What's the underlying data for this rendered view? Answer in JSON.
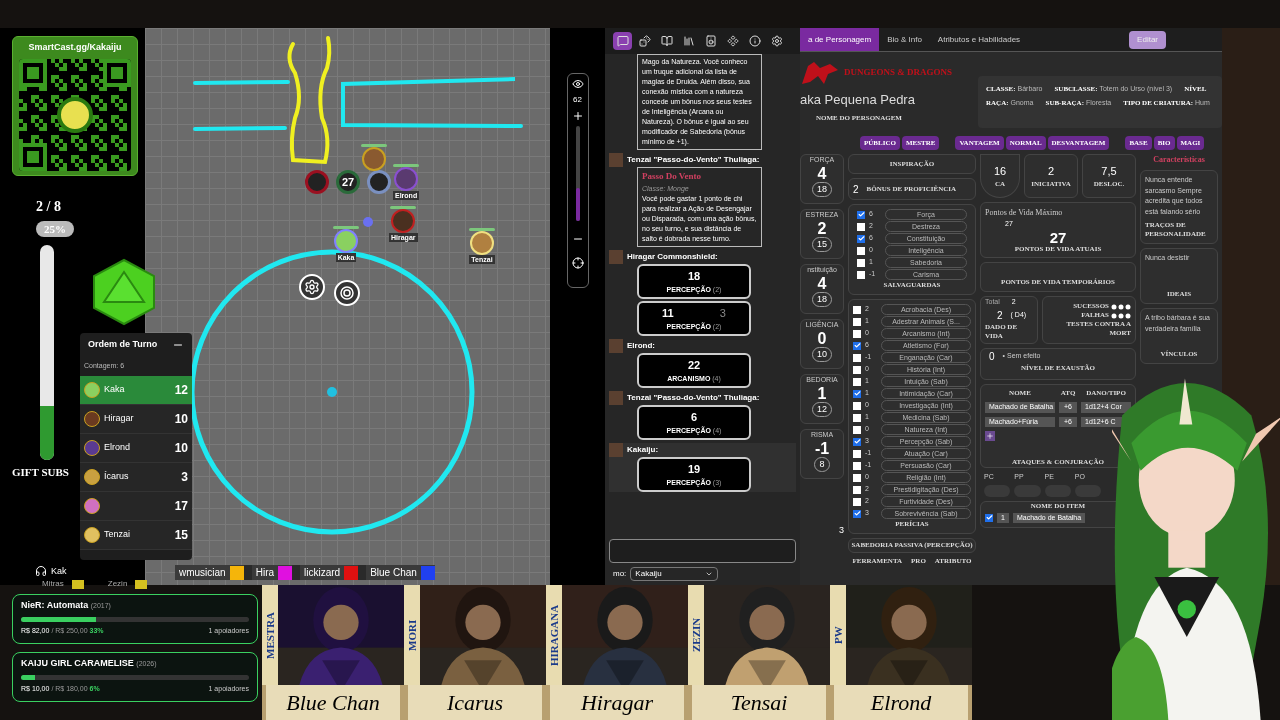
{
  "qr": {
    "url": "SmartCast.gg/Kakaiju"
  },
  "sub_goal": {
    "count": "2 / 8",
    "percent": "25%",
    "level": 0.25,
    "label": "GIFT SUBS"
  },
  "turn_order": {
    "title": "Ordem de Turno",
    "counter": "Contagem: 6",
    "entries": [
      {
        "name": "Kaka",
        "value": "12",
        "selected": true
      },
      {
        "name": "Hiragar",
        "value": "10",
        "selected": false
      },
      {
        "name": "Elrond",
        "value": "10",
        "selected": false
      },
      {
        "name": "Ícarus",
        "value": "3",
        "selected": false
      },
      {
        "value": "17",
        "selected": false
      },
      {
        "name": "Tenzai",
        "value": "15",
        "selected": false
      }
    ]
  },
  "voice": {
    "speaker": "Kak",
    "listeners": [
      {
        "name": "Mitras",
        "color": "#d4c020"
      },
      {
        "name": "Zezin",
        "color": "#d4c020"
      }
    ]
  },
  "players": [
    {
      "name": "wmusician",
      "color": "#f5b50a"
    },
    {
      "name": "Hira",
      "color": "#e010e0"
    },
    {
      "name": "lickizard",
      "color": "#e01010"
    },
    {
      "name": "Blue Chan",
      "color": "#2040f0"
    }
  ],
  "donation_goals": [
    {
      "title": "NieR: Automata",
      "year": "(2017)",
      "raised": "R$ 82,00",
      "target": "/ R$ 250,00",
      "percent": "33%",
      "level": 0.33,
      "supporters": "1 apoiadores"
    },
    {
      "title": "KAIJU GIRL CARAMELISE",
      "year": "(2026)",
      "raised": "R$ 10,00",
      "target": "/ R$ 180,00",
      "percent": "6%",
      "level": 0.06,
      "supporters": "1 apoiadores"
    }
  ],
  "map": {
    "zoom": {
      "value": "62",
      "level": 0.35
    },
    "hp_ring": "27",
    "tokens": [
      {
        "name": "Elrond"
      },
      {
        "name": "Hiragar"
      },
      {
        "name": "Kaka"
      },
      {
        "name": "Tenzai"
      }
    ]
  },
  "chat": {
    "tabs": [
      {
        "kind": "chat",
        "selected": true
      },
      {
        "kind": "dice",
        "selected": false
      },
      {
        "kind": "journal",
        "selected": false
      },
      {
        "kind": "library",
        "selected": false
      },
      {
        "kind": "jukebox",
        "selected": false
      },
      {
        "kind": "collections",
        "selected": false
      },
      {
        "kind": "info",
        "selected": false
      },
      {
        "kind": "settings",
        "selected": false
      }
    ],
    "messages": [
      {
        "kind": "card",
        "body": "Mago da Natureza. Você conheco um truque adicional da lista de magias de Druida. Além disso, sua conexão mística com a natureza concede um bônus nos seus testes de Inteligência (Arcana ou Natureza). O bônus é igual ao seu modificador de Sabedoria (bônus mínimo de +1)."
      },
      {
        "kind": "card",
        "author": "Tenzai \"Passo-do-Vento\" Thuliaga:",
        "title": "Passo Do Vento",
        "subtitle": "Classe: Monge",
        "body": "Você pode gastar 1 ponto de chi para realizar a Ação de Desengajar ou Disparada, com uma ação bônus, no seu turno, e sua distância de salto é dobrada nesse turno."
      },
      {
        "kind": "roll",
        "author": "Hiragar Commonshield:",
        "rolls": [
          {
            "values": [
              "18"
            ],
            "label": "PERCEPÇÃO",
            "mod": "(2)"
          },
          {
            "values": [
              "11",
              "3"
            ],
            "label": "PERCEPÇÃO",
            "mod": "(2)"
          }
        ]
      },
      {
        "kind": "roll",
        "author": "Elrond:",
        "rolls": [
          {
            "values": [
              "22"
            ],
            "label": "ARCANISMO",
            "mod": "(4)"
          }
        ]
      },
      {
        "kind": "roll",
        "author": "Tenzai \"Passo-do-Vento\" Thuliaga:",
        "rolls": [
          {
            "values": [
              "6"
            ],
            "label": "PERCEPÇÃO",
            "mod": "(4)"
          }
        ]
      },
      {
        "kind": "roll",
        "author": "Kakaiju:",
        "rolls": [
          {
            "values": [
              "19"
            ],
            "label": "PERCEPÇÃO",
            "mod": "(3)"
          }
        ]
      }
    ],
    "speaking_as_label": "mo:",
    "speaking_as": "Kakaiju"
  },
  "sheet": {
    "tabs": [
      {
        "label": "a de Personagem",
        "selected": true
      },
      {
        "label": "Bio & Info",
        "selected": false
      },
      {
        "label": "Atributos e Habilidades",
        "selected": false
      }
    ],
    "edit_button": "Editar",
    "logo": "DUNGEONS & DRAGONS",
    "name": "aka Pequena Pedra",
    "name_label": "NOME DO PERSONAGEM",
    "info": [
      {
        "label": "CLASSE:",
        "value": "Bárbaro"
      },
      {
        "label": "SUBCLASSE:",
        "value": "Totem do Urso (nível 3)"
      },
      {
        "label": "NÍVEL"
      },
      {
        "label": "RAÇA:",
        "value": "Gnoma"
      },
      {
        "label": "SUB-RAÇA:",
        "value": "Floresta"
      },
      {
        "label": "TIPO DE CRIATURA:",
        "value": "Hum"
      }
    ],
    "toggles": [
      [
        "PÚBLICO",
        "MESTRE"
      ],
      [
        "VANTAGEM",
        "NORMAL",
        "DESVANTAGEM"
      ],
      [
        "BASE",
        "BIO",
        "MAGI"
      ]
    ],
    "attributes": [
      {
        "label": "FORÇA",
        "mod": "4",
        "score": "18"
      },
      {
        "label": "ESTREZA",
        "mod": "2",
        "score": "15"
      },
      {
        "label": "nstituição",
        "mod": "4",
        "score": "18"
      },
      {
        "label": "LIGÊNCIA",
        "mod": "0",
        "score": "10"
      },
      {
        "label": "BEDORIA",
        "mod": "1",
        "score": "12"
      },
      {
        "label": "RISMA",
        "mod": "-1",
        "score": "8"
      }
    ],
    "inspiration": "INSPIRAÇÃO",
    "proficiency": "2",
    "proficiency_label": "BÔNUS DE PROFICIÊNCIA",
    "saves_title": "SALVAGUARDAS",
    "saves": [
      {
        "checked": true,
        "mod": "6",
        "name": "Força"
      },
      {
        "checked": false,
        "mod": "2",
        "name": "Destreza"
      },
      {
        "checked": true,
        "mod": "6",
        "name": "Constituição"
      },
      {
        "checked": false,
        "mod": "0",
        "name": "Inteligência"
      },
      {
        "checked": false,
        "mod": "1",
        "name": "Sabedoria"
      },
      {
        "checked": false,
        "mod": "-1",
        "name": "Carisma"
      }
    ],
    "skills_title": "PERÍCIAS",
    "skills": [
      {
        "checked": false,
        "mod": "2",
        "name": "Acrobacia (Des)"
      },
      {
        "checked": false,
        "mod": "1",
        "name": "Adestrar Animais (S..."
      },
      {
        "checked": false,
        "mod": "0",
        "name": "Arcanismo (Int)"
      },
      {
        "checked": true,
        "mod": "6",
        "name": "Atletismo (For)"
      },
      {
        "checked": false,
        "mod": "-1",
        "name": "Enganação (Car)"
      },
      {
        "checked": false,
        "mod": "0",
        "name": "História (Int)"
      },
      {
        "checked": false,
        "mod": "1",
        "name": "Intuição (Sab)"
      },
      {
        "checked": true,
        "mod": "1",
        "name": "Intimidação (Car)"
      },
      {
        "checked": false,
        "mod": "0",
        "name": "Investigação (Int)"
      },
      {
        "checked": false,
        "mod": "1",
        "name": "Medicina (Sab)"
      },
      {
        "checked": false,
        "mod": "0",
        "name": "Natureza (Int)"
      },
      {
        "checked": true,
        "mod": "3",
        "name": "Percepção (Sab)"
      },
      {
        "checked": false,
        "mod": "-1",
        "name": "Atuação (Car)"
      },
      {
        "checked": false,
        "mod": "-1",
        "name": "Persuasão (Car)"
      },
      {
        "checked": false,
        "mod": "0",
        "name": "Religião (Int)"
      },
      {
        "checked": false,
        "mod": "2",
        "name": "Prestidigitação (Des)"
      },
      {
        "checked": false,
        "mod": "2",
        "name": "Furtividade (Des)"
      },
      {
        "checked": true,
        "mod": "3",
        "name": "Sobrevivência (Sab)"
      }
    ],
    "passive": "3",
    "passive_label": "SABEDORIA PASSIVA (PERCEPÇÃO)",
    "tools_columns": [
      "FERRAMENTA",
      "PRO",
      "ATRIBUTO"
    ],
    "ac": "16",
    "ac_label": "CA",
    "initiative": "2",
    "initiative_label": "INICIATIVA",
    "speed": "7,5",
    "speed_label": "DESLOC.",
    "hp_max_label": "Pontos de Vida Máximo",
    "hp_max": "27",
    "hp": "27",
    "hp_label": "PONTOS DE VIDA ATUAIS",
    "temp_hp_label": "PONTOS DE VIDA TEMPORÁRIOS",
    "hit_dice_total_label": "Total",
    "hit_dice_total": "2",
    "hit_dice": "2",
    "hit_dice_label": "DADO DE VIDA",
    "hit_die": "( D4)",
    "death_saves": [
      {
        "label": "SUCESSOS"
      },
      {
        "label": "FALHAS"
      }
    ],
    "death_saves_label": "TESTES CONTRA A MORT",
    "exhaustion": "0",
    "exhaustion_note": "• Sem efeito",
    "exhaustion_label": "NÍVEL DE EXAUSTÃO",
    "attack_columns": [
      "NOME",
      "ATQ",
      "DANO/TIPO"
    ],
    "attacks": [
      {
        "name": "Machado de Batalha",
        "bonus": "+6",
        "damage": "1d12+4 Cor"
      },
      {
        "name": "Machado+Fúria",
        "bonus": "+6",
        "damage": "1d12+6 C"
      }
    ],
    "attacks_label": "ATAQUES & CONJURAÇÃO",
    "coins": [
      "PC",
      "PP",
      "PE",
      "PO"
    ],
    "items_label": "NOME DO ITEM",
    "items": [
      {
        "checked": true,
        "qty": "1",
        "name": "Machado de Batalha"
      }
    ],
    "traits_title": "Características",
    "traits": [
      {
        "text": "Nunca entende sarcasmo Sempre acredita que todos está falando sério",
        "label": "TRAÇOS DE PERSONALIDADE"
      },
      {
        "text": "Nunca desistir",
        "label": "IDEAIS"
      },
      {
        "text": "A tribo bárbara é sua verdadeira família",
        "label": "VÍNCULOS"
      }
    ]
  },
  "portraits": [
    {
      "title": "MESTRA",
      "name": "Blue Chan"
    },
    {
      "title": "MORI",
      "name": "Icarus"
    },
    {
      "title": "HIRAGANA",
      "name": "Hiragar"
    },
    {
      "title": "ZEZIN",
      "name": "Tensai"
    },
    {
      "title": "PW",
      "name": "Elrond"
    }
  ]
}
